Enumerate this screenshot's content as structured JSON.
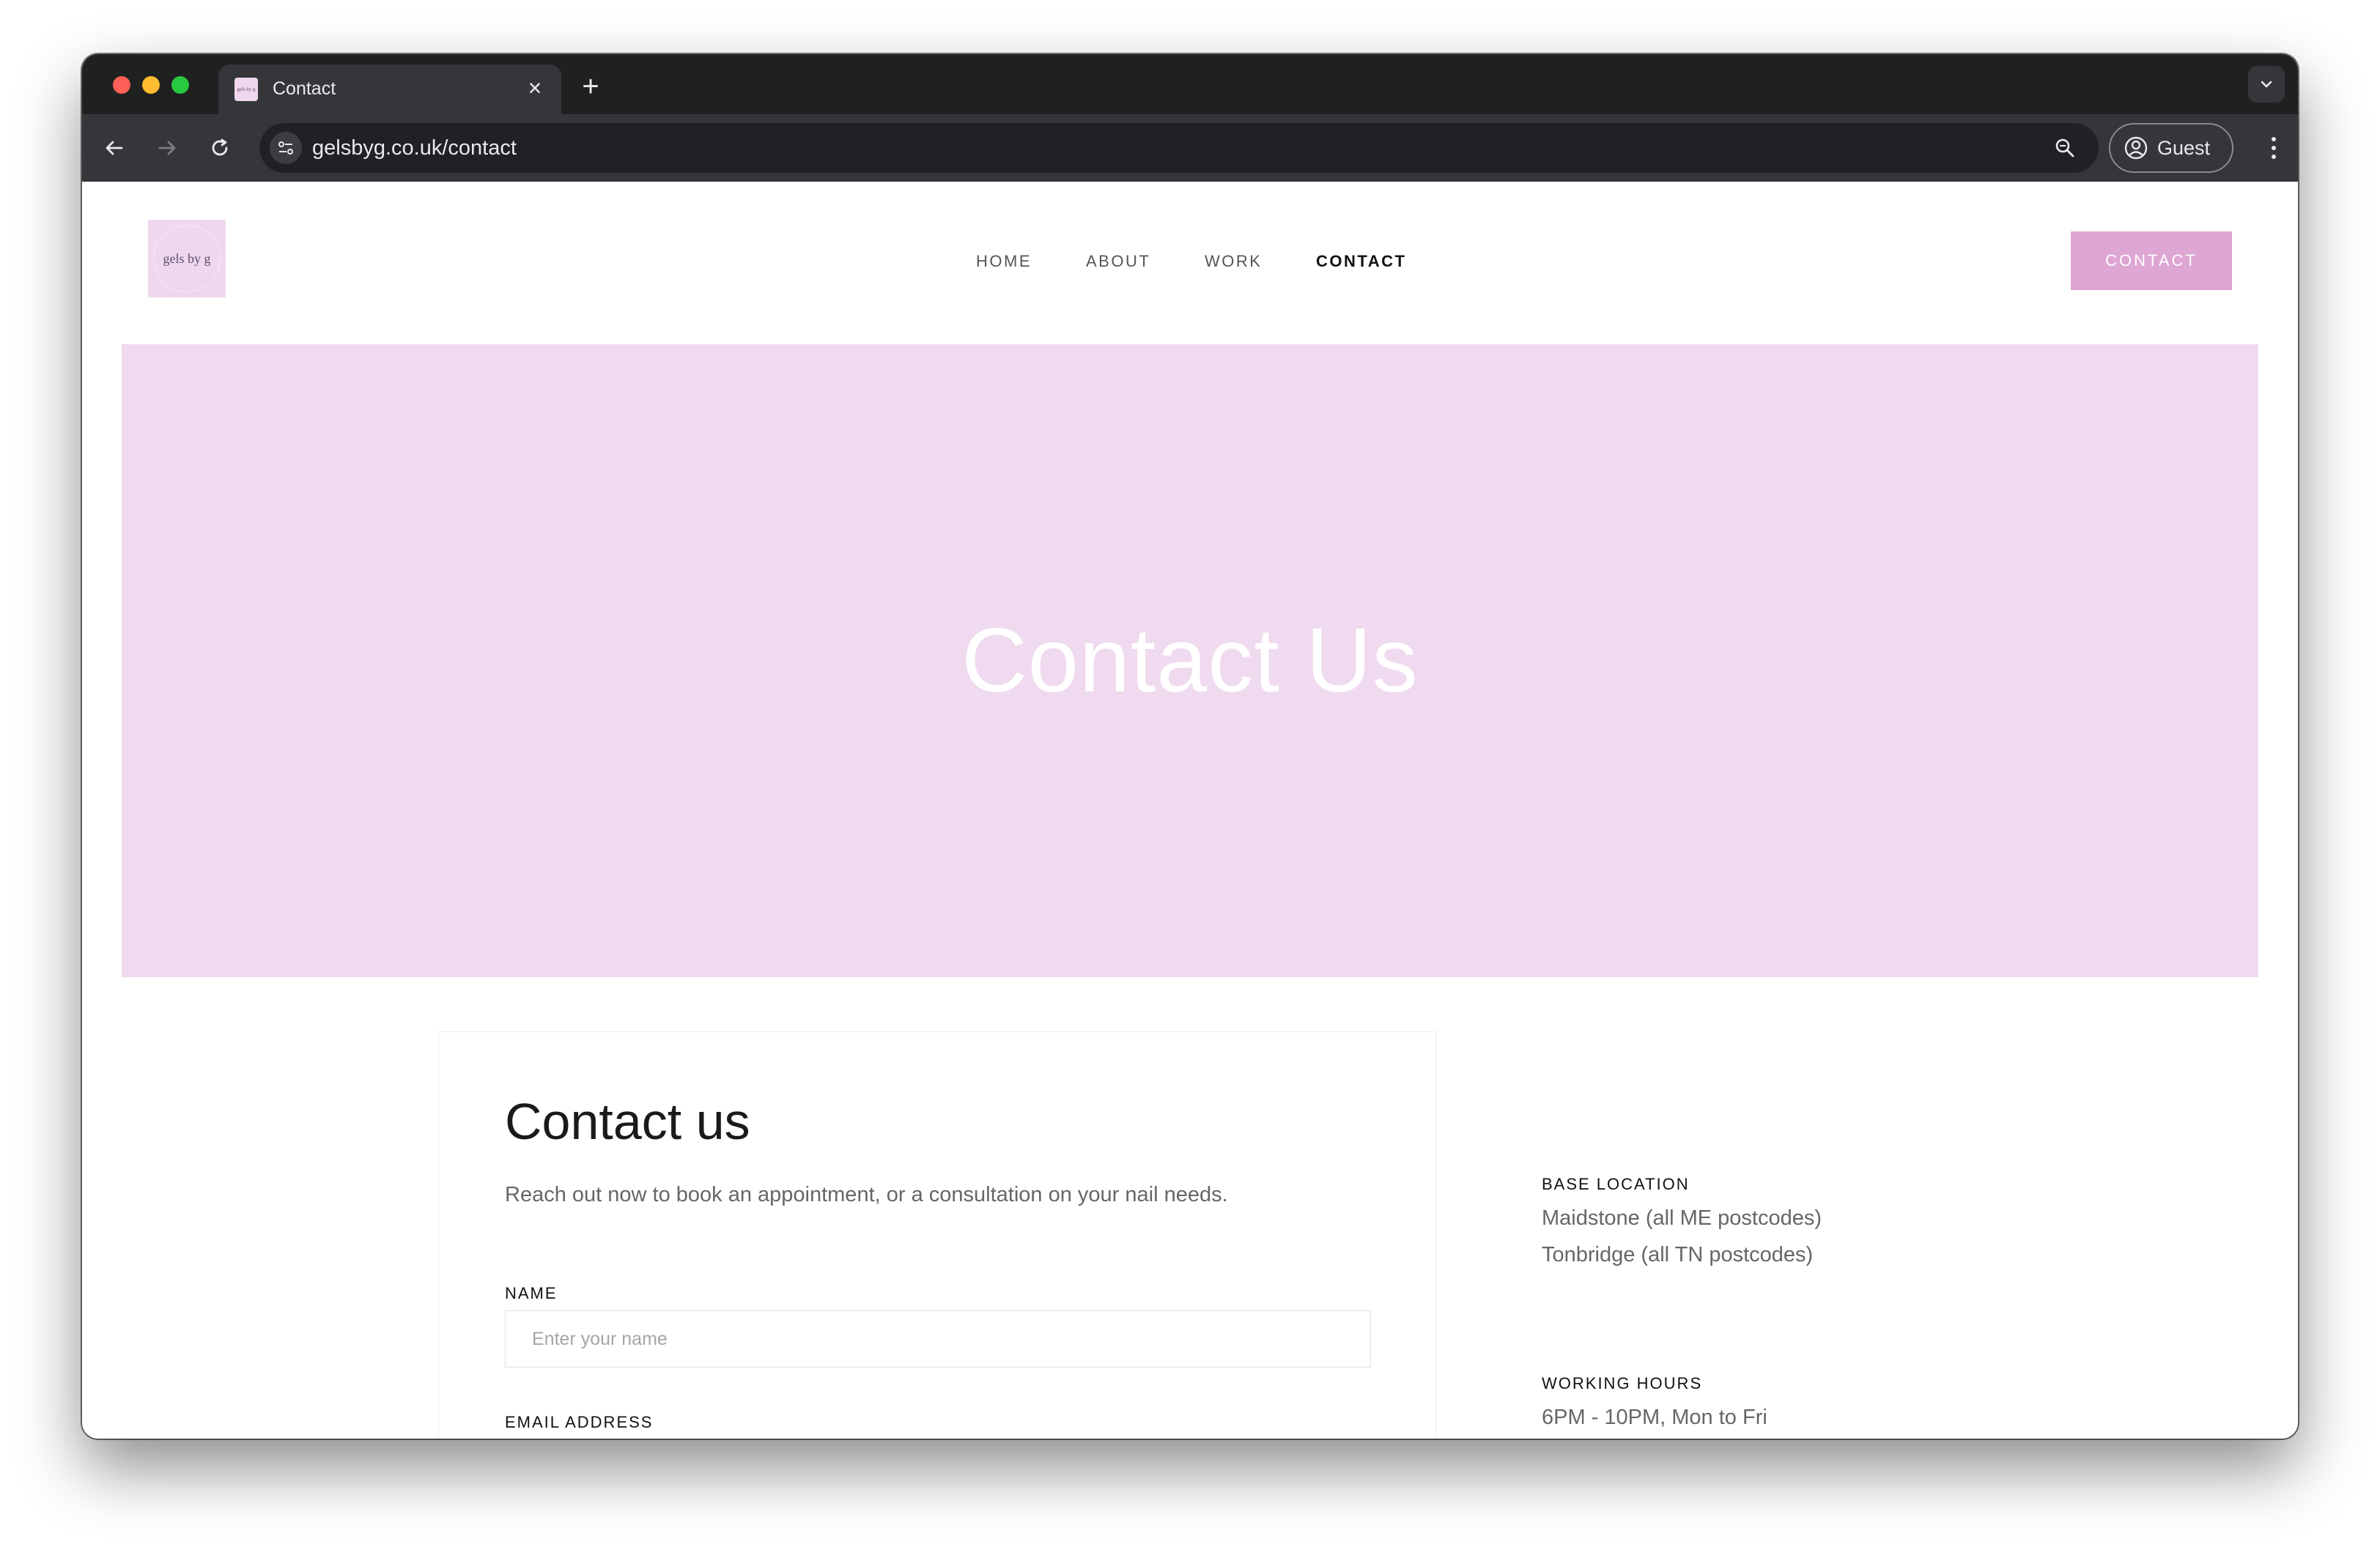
{
  "browser": {
    "tab_title": "Contact",
    "tab_favicon_text": "gels by g",
    "url": "gelsbyg.co.uk/contact",
    "profile_label": "Guest",
    "icons": [
      "back-arrow-icon",
      "forward-arrow-icon",
      "reload-icon",
      "site-info-icon",
      "zoom-icon",
      "profile-icon",
      "more-icon",
      "close-icon",
      "plus-icon",
      "chevron-down-icon"
    ]
  },
  "site": {
    "logo_text": "gels by g",
    "nav": [
      "HOME",
      "ABOUT",
      "WORK",
      "CONTACT"
    ],
    "active_nav": "CONTACT",
    "cta_label": "CONTACT",
    "colors": {
      "accent": "#dea6d2",
      "hero_bg": "#f0daef"
    }
  },
  "hero": {
    "title": "Contact Us"
  },
  "form": {
    "title": "Contact us",
    "subtitle": "Reach out now to book an appointment, or a consultation on your nail needs.",
    "name_label": "NAME",
    "name_placeholder": "Enter your name",
    "email_label": "EMAIL ADDRESS"
  },
  "info": {
    "location_label": "BASE LOCATION",
    "location_lines": [
      "Maidstone (all ME postcodes)",
      "Tonbridge (all TN postcodes)"
    ],
    "hours_label": "WORKING HOURS",
    "hours_text": "6PM - 10PM, Mon to Fri"
  }
}
